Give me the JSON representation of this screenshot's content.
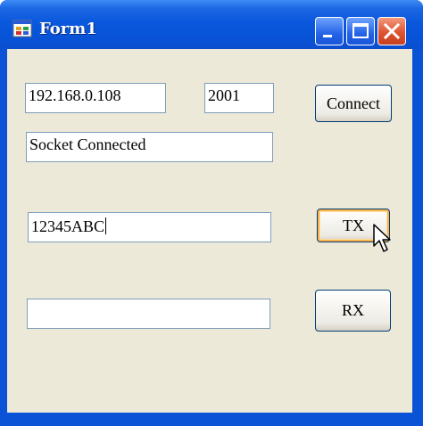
{
  "window": {
    "title": "Form1",
    "colors": {
      "titlebar": "#0a58dd",
      "client": "#ece9d8",
      "close_button": "#de5432",
      "textbox_border": "#7f9db9",
      "button_border": "#003c74",
      "hot_button_highlight": "#f9b24b"
    },
    "icons": {
      "app": "form-app-icon",
      "minimize": "minimize-icon",
      "maximize": "maximize-icon",
      "close": "close-icon",
      "cursor": "mouse-pointer-icon"
    }
  },
  "connection": {
    "ip_value": "192.168.0.108",
    "port_value": "2001",
    "connect_label": "Connect",
    "status_value": "Socket Connected"
  },
  "transmit": {
    "tx_value": "12345ABC",
    "tx_label": "TX"
  },
  "receive": {
    "rx_value": "",
    "rx_label": "RX"
  }
}
